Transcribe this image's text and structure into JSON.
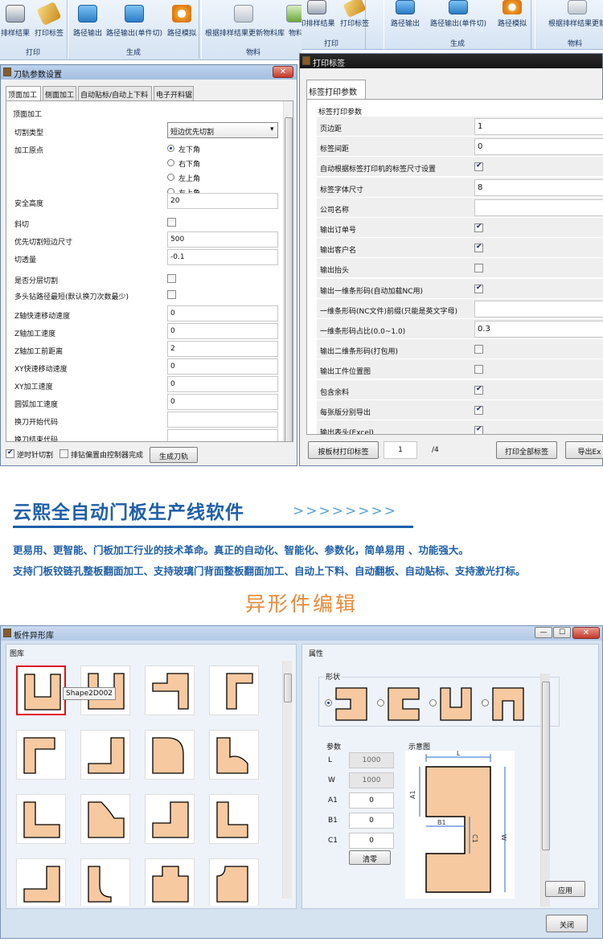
{
  "ribbon_left": {
    "buttons": [
      "排样结果",
      "打印标签",
      "路径输出",
      "路径输出(单件切)",
      "路径模拟",
      "根据排样结果更新物料库",
      "物料"
    ],
    "groups": [
      "打印",
      "生成",
      "物料"
    ]
  },
  "ribbon_right": {
    "buttons": [
      "印排样结果",
      "打印标签",
      "路径输出",
      "路径输出(单件切)",
      "路径模拟",
      "根据排样结果更新"
    ],
    "groups": [
      "打印",
      "生成",
      "物料"
    ]
  },
  "tool_window": {
    "title": "刀轨参数设置",
    "close": "✕",
    "tabs": [
      "顶面加工",
      "侧面加工",
      "自动贴标/自动上下料",
      "电子开料锯"
    ],
    "group": "顶面加工",
    "rows": [
      {
        "label": "切割类型",
        "type": "select",
        "value": "短边优先切割"
      },
      {
        "label": "加工原点",
        "type": "radio",
        "options": [
          "左下角",
          "右下角",
          "左上角",
          "右上角"
        ],
        "selected": 0
      },
      {
        "label": "安全高度",
        "type": "text",
        "value": "20"
      },
      {
        "label": "斜切",
        "type": "check",
        "checked": false
      },
      {
        "label": "优先切割短边尺寸",
        "type": "text",
        "value": "500"
      },
      {
        "label": "切透量",
        "type": "text",
        "value": "-0.1"
      },
      {
        "label": "是否分层切割",
        "type": "check",
        "checked": false
      },
      {
        "label": "多头钻路径最短(默认换刀次数最少)",
        "type": "check",
        "checked": false
      },
      {
        "label": "Z轴快速移动速度",
        "type": "text",
        "value": "0"
      },
      {
        "label": "Z轴加工速度",
        "type": "text",
        "value": "0"
      },
      {
        "label": "Z轴加工前距离",
        "type": "text",
        "value": "2"
      },
      {
        "label": "XY快速移动速度",
        "type": "text",
        "value": "0"
      },
      {
        "label": "XY加工速度",
        "type": "text",
        "value": "0"
      },
      {
        "label": "圆弧加工速度",
        "type": "text",
        "value": "0"
      },
      {
        "label": "换刀开始代码",
        "type": "text",
        "value": ""
      },
      {
        "label": "换刀结束代码",
        "type": "text",
        "value": ""
      }
    ],
    "bottom": {
      "ccw_label": "逆时针切割",
      "ccw": true,
      "ctrl_label": "排钻偏置由控制器完成",
      "ctrl": false,
      "generate": "生成刀轨"
    }
  },
  "label_window": {
    "title": "打印标签",
    "tab": "标签打印参数",
    "group": "标签打印参数",
    "rows": [
      {
        "label": "页边距",
        "type": "text",
        "value": "1"
      },
      {
        "label": "标签间距",
        "type": "text",
        "value": "0"
      },
      {
        "label": "自动根据标签打印机的标签尺寸设置",
        "type": "check",
        "checked": true
      },
      {
        "label": "标签字体尺寸",
        "type": "text",
        "value": "8"
      },
      {
        "label": "公司名称",
        "type": "text",
        "value": ""
      },
      {
        "label": "输出订单号",
        "type": "check",
        "checked": true
      },
      {
        "label": "输出客户名",
        "type": "check",
        "checked": true
      },
      {
        "label": "输出抬头",
        "type": "check",
        "checked": false
      },
      {
        "label": "输出一维条形码(自动加载NC用)",
        "type": "check",
        "checked": true
      },
      {
        "label": "一维条形码(NC文件)前缀(只能是英文字母)",
        "type": "text",
        "value": ""
      },
      {
        "label": "一维条形码占比(0.0~1.0)",
        "type": "text",
        "value": "0.3"
      },
      {
        "label": "输出二维条形码(打包用)",
        "type": "check",
        "checked": false
      },
      {
        "label": "输出工件位置图",
        "type": "check",
        "checked": false
      },
      {
        "label": "包含余料",
        "type": "check",
        "checked": true
      },
      {
        "label": "每张版分别导出",
        "type": "check",
        "checked": true
      },
      {
        "label": "输出表头(Excel)",
        "type": "check",
        "checked": true
      }
    ],
    "bottom": {
      "print_by_board": "按板材打印标签",
      "page": "1",
      "total": "/4",
      "print_all": "打印全部标签",
      "export": "导出Ex"
    }
  },
  "banner": {
    "title": "云熙全自动门板生产线软件",
    "arrows": ">>>>>>>>",
    "line1": "更易用、更智能、门板加工行业的技术革命。真正的自动化、智能化、参数化，简单易用 、功能强大。",
    "line2": "支持门板铰链孔整板翻面加工、支持玻璃门背面整板翻面加工、自动上下料、自动翻板、自动贴标、支持激光打标。",
    "section": "异形件编辑"
  },
  "shape_window": {
    "title": "板件异形库",
    "library_label": "图库",
    "tooltip": "Shape2D002",
    "props_label": "属性",
    "shape_label": "形状",
    "params_label": "参数",
    "preview_label": "示意图",
    "params": [
      {
        "name": "L",
        "value": "1000",
        "disabled": true
      },
      {
        "name": "W",
        "value": "1000",
        "disabled": true
      },
      {
        "name": "A1",
        "value": "0",
        "disabled": false
      },
      {
        "name": "B1",
        "value": "0",
        "disabled": false
      },
      {
        "name": "C1",
        "value": "0",
        "disabled": false
      }
    ],
    "clear": "清零",
    "apply": "应用",
    "close": "关闭",
    "dim": {
      "L": "L",
      "W": "W",
      "A1": "A1",
      "B1": "B1",
      "C1": "C1"
    },
    "colors": {
      "shape_fill": "#f6c9a0",
      "select_border": "#e01010",
      "banner_blue": "#1f5fa8",
      "banner_orange": "#e88a3a"
    }
  }
}
